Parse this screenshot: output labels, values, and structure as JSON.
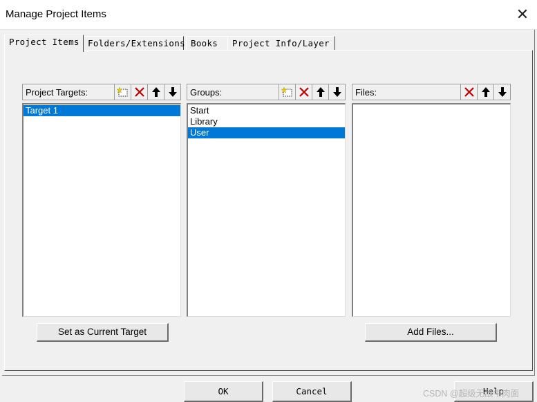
{
  "window": {
    "title": "Manage Project Items",
    "close_glyph": "✕"
  },
  "tabs": [
    {
      "label": "Project Items",
      "active": true
    },
    {
      "label": "Folders/Extensions",
      "active": false
    },
    {
      "label": "Books",
      "active": false
    },
    {
      "label": "Project Info/Layer",
      "active": false
    }
  ],
  "targets": {
    "label": "Project Targets:",
    "items": [
      "Target 1"
    ],
    "selected": "Target 1",
    "icons": [
      "new-icon",
      "delete-icon",
      "move-up-icon",
      "move-down-icon"
    ]
  },
  "groups": {
    "label": "Groups:",
    "items": [
      "Start",
      "Library",
      "User"
    ],
    "selected": "User",
    "icons": [
      "new-icon",
      "delete-icon",
      "move-up-icon",
      "move-down-icon"
    ]
  },
  "files": {
    "label": "Files:",
    "items": [],
    "icons": [
      "delete-icon",
      "move-up-icon",
      "move-down-icon"
    ]
  },
  "buttons": {
    "set_current": "Set as Current Target",
    "add_files": "Add Files...",
    "ok": "OK",
    "cancel": "Cancel",
    "help": "Help"
  },
  "watermark": "CSDN @超级无敌牛肉面",
  "colors": {
    "selection": "#0078d7",
    "delete_red": "#c00000",
    "new_icon_yellow": "#f2d200"
  }
}
